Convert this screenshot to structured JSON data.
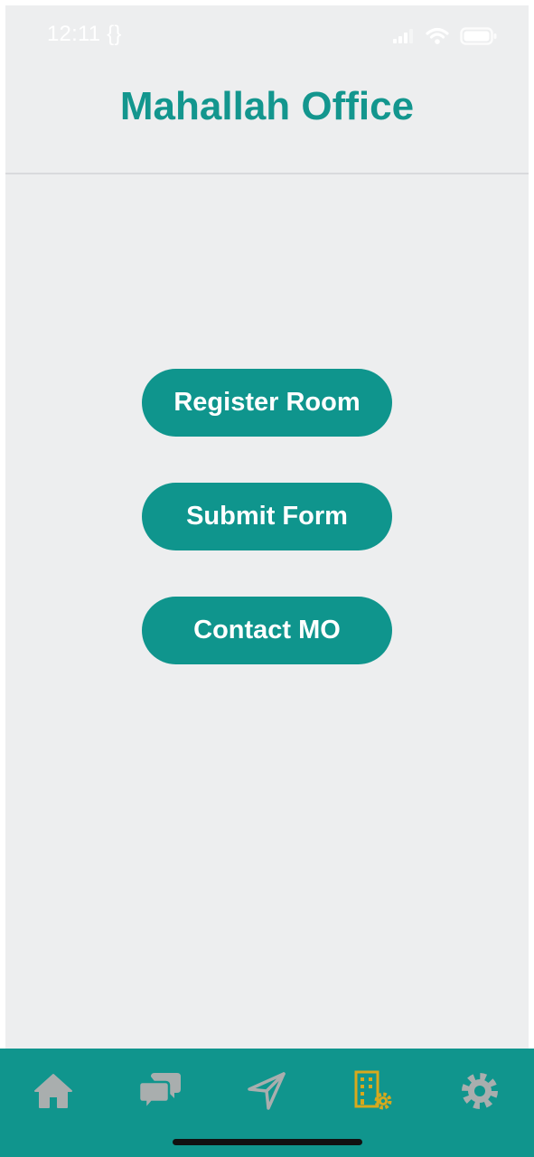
{
  "status_bar": {
    "time": "12:11 {}"
  },
  "header": {
    "title": "Mahallah Office"
  },
  "actions": {
    "register_room": "Register Room",
    "submit_form": "Submit Form",
    "contact_mo": "Contact MO"
  },
  "tab_bar": {
    "active": "office",
    "items": [
      {
        "icon": "home-icon",
        "active": false
      },
      {
        "icon": "chat-icon",
        "active": false
      },
      {
        "icon": "navigation-arrow-icon",
        "active": false
      },
      {
        "icon": "office-building-gear-icon",
        "active": true
      },
      {
        "icon": "settings-gear-icon",
        "active": false
      }
    ]
  },
  "colors": {
    "accent": "#13968e",
    "tab_bar_bg": "#10958d",
    "inactive_icon": "#a9aeae",
    "active_icon": "#d8a91c",
    "surface": "#edeeef"
  }
}
